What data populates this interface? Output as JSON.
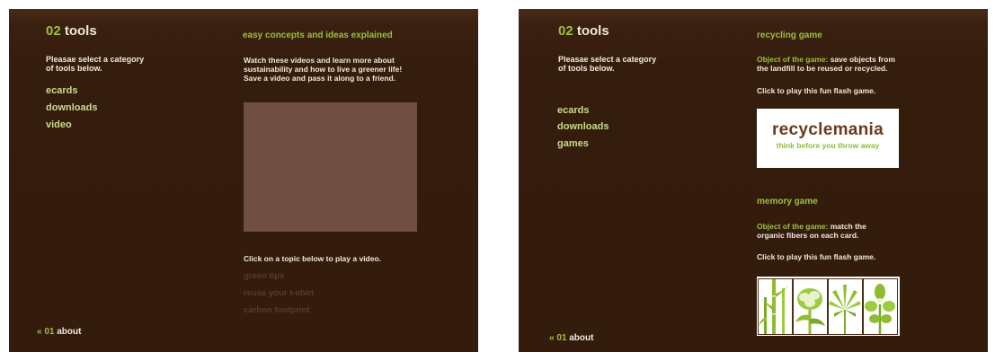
{
  "left": {
    "heading_num": "02",
    "heading_text": "tools",
    "subtitle_line1": "Pleasae select a category",
    "subtitle_line2": "of tools below.",
    "nav": [
      "ecards",
      "downloads",
      "video"
    ],
    "section_title": "easy concepts and ideas explained",
    "description_lines": [
      "Watch these videos and learn more about",
      "sustainability and how to live a greener life!",
      "Save a video and pass it along to a friend."
    ],
    "prompt": "Click on a topic below to play a video.",
    "topics": [
      "green tips",
      "reuse your t-shirt",
      "carbon footprint"
    ],
    "back_prefix": "«",
    "back_num": "01",
    "back_text": "about"
  },
  "right": {
    "heading_num": "02",
    "heading_text": "tools",
    "subtitle_line1": "Pleasae select a category",
    "subtitle_line2": "of tools below.",
    "nav": [
      "ecards",
      "downloads",
      "games"
    ],
    "recycling": {
      "title": "recycling game",
      "object_label": "Object of the game:",
      "object_line1": " save objects from",
      "object_line2": "the landfill to be reused or recycled.",
      "play": "Click to play this fun flash game.",
      "banner_title": "recyclemania",
      "banner_tagline": "think before you throw away"
    },
    "memory": {
      "title": "memory game",
      "object_label": "Object of the game:",
      "object_line1": " match the",
      "object_line2": "organic fibers on each card.",
      "play": "Click to play this fun flash game."
    },
    "back_prefix": "«",
    "back_num": "01",
    "back_text": "about"
  },
  "colors": {
    "background": "#341c0d",
    "accent_green": "#9ac23c",
    "text_cream": "#f1e9d7",
    "muted_topic": "#5a3a26",
    "video_box": "#6e4f41"
  }
}
